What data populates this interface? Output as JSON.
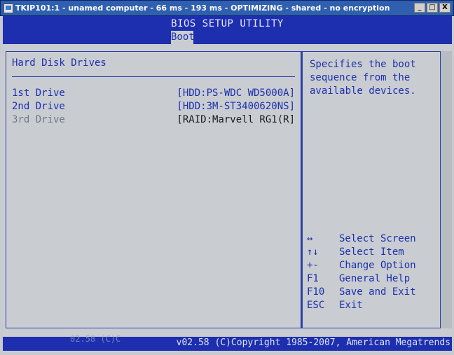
{
  "window": {
    "title": "TKIP101:1 - unamed computer - 66 ms - 193 ms - OPTIMIZING - shared - no encryption",
    "buttons": [
      "_",
      "□",
      "X"
    ]
  },
  "bios": {
    "title": "BIOS SETUP UTILITY",
    "active_tab": "Boot",
    "section_title": "Hard Disk Drives",
    "drives": [
      {
        "label": "1st Drive",
        "value": "[HDD:PS-WDC WD5000A]"
      },
      {
        "label": "2nd Drive",
        "value": "[HDD:3M-ST3400620NS]"
      },
      {
        "label": "3rd Drive",
        "value": "[RAID:Marvell RG1(R]"
      }
    ],
    "help_text": "Specifies the boot sequence from the available devices.",
    "keys": [
      {
        "key": "↔",
        "desc": "Select Screen"
      },
      {
        "key": "↑↓",
        "desc": "Select Item"
      },
      {
        "key": "+-",
        "desc": "Change Option"
      },
      {
        "key": "F1",
        "desc": "General Help"
      },
      {
        "key": "F10",
        "desc": "Save and Exit"
      },
      {
        "key": "ESC",
        "desc": "Exit"
      }
    ],
    "footer_ghost": "02.58 (C)C",
    "footer": "v02.58 (C)Copyright 1985-2007, American Megatrends"
  },
  "colors": {
    "bios_blue": "#1d2fae",
    "bios_bg": "#c9cdd1",
    "titlebar": "#2f5fae"
  }
}
